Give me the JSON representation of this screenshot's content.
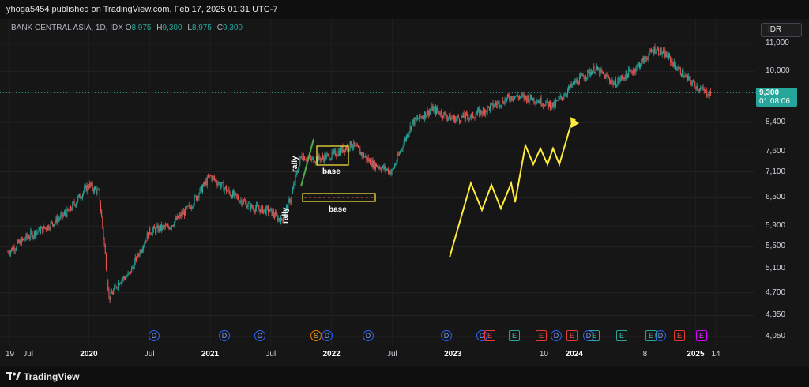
{
  "header": {
    "publish_line": "yhoga5454 published on TradingView.com, Feb 17, 2025 01:31 UTC-7"
  },
  "legend": {
    "symbol": "BANK CENTRAL ASIA, 1D, IDX",
    "open_label": "O",
    "open": "8,975",
    "high_label": "H",
    "high": "9,300",
    "low_label": "L",
    "low": "8,975",
    "close_label": "C",
    "close": "9,300"
  },
  "currency": "IDR",
  "price_tag": {
    "price": "9,300",
    "countdown": "01:08:06"
  },
  "footer": {
    "brand": "TradingView"
  },
  "annotations": {
    "rally_1": "rally",
    "rally_2": "rally",
    "base_1": "base",
    "base_2": "base"
  },
  "colors": {
    "up": "#26a69a",
    "down": "#ef5350",
    "annotation": "#ffeb3b",
    "rally_line": "#4caf50",
    "price_line": "#26a69a"
  },
  "chart_data": {
    "type": "candlestick",
    "title": "BANK CENTRAL ASIA, 1D, IDX",
    "y_scale": "log",
    "y_ticks": [
      4050,
      4350,
      4700,
      5100,
      5500,
      5900,
      6500,
      7100,
      7600,
      8400,
      9300,
      10000,
      11000
    ],
    "y_tick_labels": [
      "4,050",
      "4,350",
      "4,700",
      "5,100",
      "5,500",
      "5,900",
      "6,500",
      "7,100",
      "7,600",
      "8,400",
      "9,300",
      "10,000",
      "11,000"
    ],
    "x_tick_labels": [
      "19",
      "Jul",
      "2020",
      "Jul",
      "2021",
      "Jul",
      "2022",
      "Jul",
      "2023",
      "10",
      "2024",
      "8",
      "2025",
      "14"
    ],
    "x_tick_bold": [
      false,
      false,
      true,
      false,
      true,
      false,
      true,
      false,
      true,
      false,
      true,
      false,
      true,
      false
    ],
    "ylim": [
      4050,
      11000
    ],
    "last_price": 9300,
    "price_path": [
      [
        "2019-05",
        5400
      ],
      [
        "2019-07",
        5700
      ],
      [
        "2019-09",
        5900
      ],
      [
        "2019-11",
        6200
      ],
      [
        "2020-01",
        6800
      ],
      [
        "2020-02",
        6600
      ],
      [
        "2020-03",
        4600
      ],
      [
        "2020-04",
        4900
      ],
      [
        "2020-05",
        5000
      ],
      [
        "2020-07",
        5800
      ],
      [
        "2020-09",
        5900
      ],
      [
        "2020-11",
        6300
      ],
      [
        "2021-01",
        7000
      ],
      [
        "2021-03",
        6600
      ],
      [
        "2021-05",
        6300
      ],
      [
        "2021-07",
        6200
      ],
      [
        "2021-08",
        6000
      ],
      [
        "2021-09",
        6500
      ],
      [
        "2021-10",
        7500
      ],
      [
        "2021-11",
        7400
      ],
      [
        "2022-01",
        7500
      ],
      [
        "2022-03",
        7800
      ],
      [
        "2022-05",
        7300
      ],
      [
        "2022-07",
        7100
      ],
      [
        "2022-09",
        8400
      ],
      [
        "2022-11",
        8800
      ],
      [
        "2023-01",
        8500
      ],
      [
        "2023-03",
        8600
      ],
      [
        "2023-05",
        8900
      ],
      [
        "2023-07",
        9200
      ],
      [
        "2023-09",
        9100
      ],
      [
        "2023-11",
        8900
      ],
      [
        "2024-01",
        9600
      ],
      [
        "2024-03",
        10100
      ],
      [
        "2024-05",
        9600
      ],
      [
        "2024-07",
        10100
      ],
      [
        "2024-09",
        10800
      ],
      [
        "2024-10",
        10600
      ],
      [
        "2024-12",
        9800
      ],
      [
        "2025-02",
        9300
      ]
    ],
    "events": [
      {
        "type": "dividend",
        "label": "D"
      },
      {
        "type": "dividend",
        "label": "D"
      },
      {
        "type": "dividend",
        "label": "D"
      },
      {
        "type": "split",
        "label": "S"
      },
      {
        "type": "dividend",
        "label": "D"
      },
      {
        "type": "dividend",
        "label": "D"
      },
      {
        "type": "dividend",
        "label": "D"
      },
      {
        "type": "dividend",
        "label": "D"
      },
      {
        "type": "earnings-red",
        "label": "E"
      },
      {
        "type": "earnings-green",
        "label": "E"
      },
      {
        "type": "earnings-red",
        "label": "E"
      },
      {
        "type": "dividend",
        "label": "D"
      },
      {
        "type": "earnings-red",
        "label": "E"
      },
      {
        "type": "dividend",
        "label": "D"
      },
      {
        "type": "earnings-green",
        "label": "E"
      },
      {
        "type": "earnings-green",
        "label": "E"
      },
      {
        "type": "earnings-green",
        "label": "E"
      },
      {
        "type": "dividend",
        "label": "D"
      },
      {
        "type": "earnings-red",
        "label": "E"
      },
      {
        "type": "earnings-purple",
        "label": "E"
      }
    ],
    "grid": true,
    "legend_position": "top-left"
  }
}
